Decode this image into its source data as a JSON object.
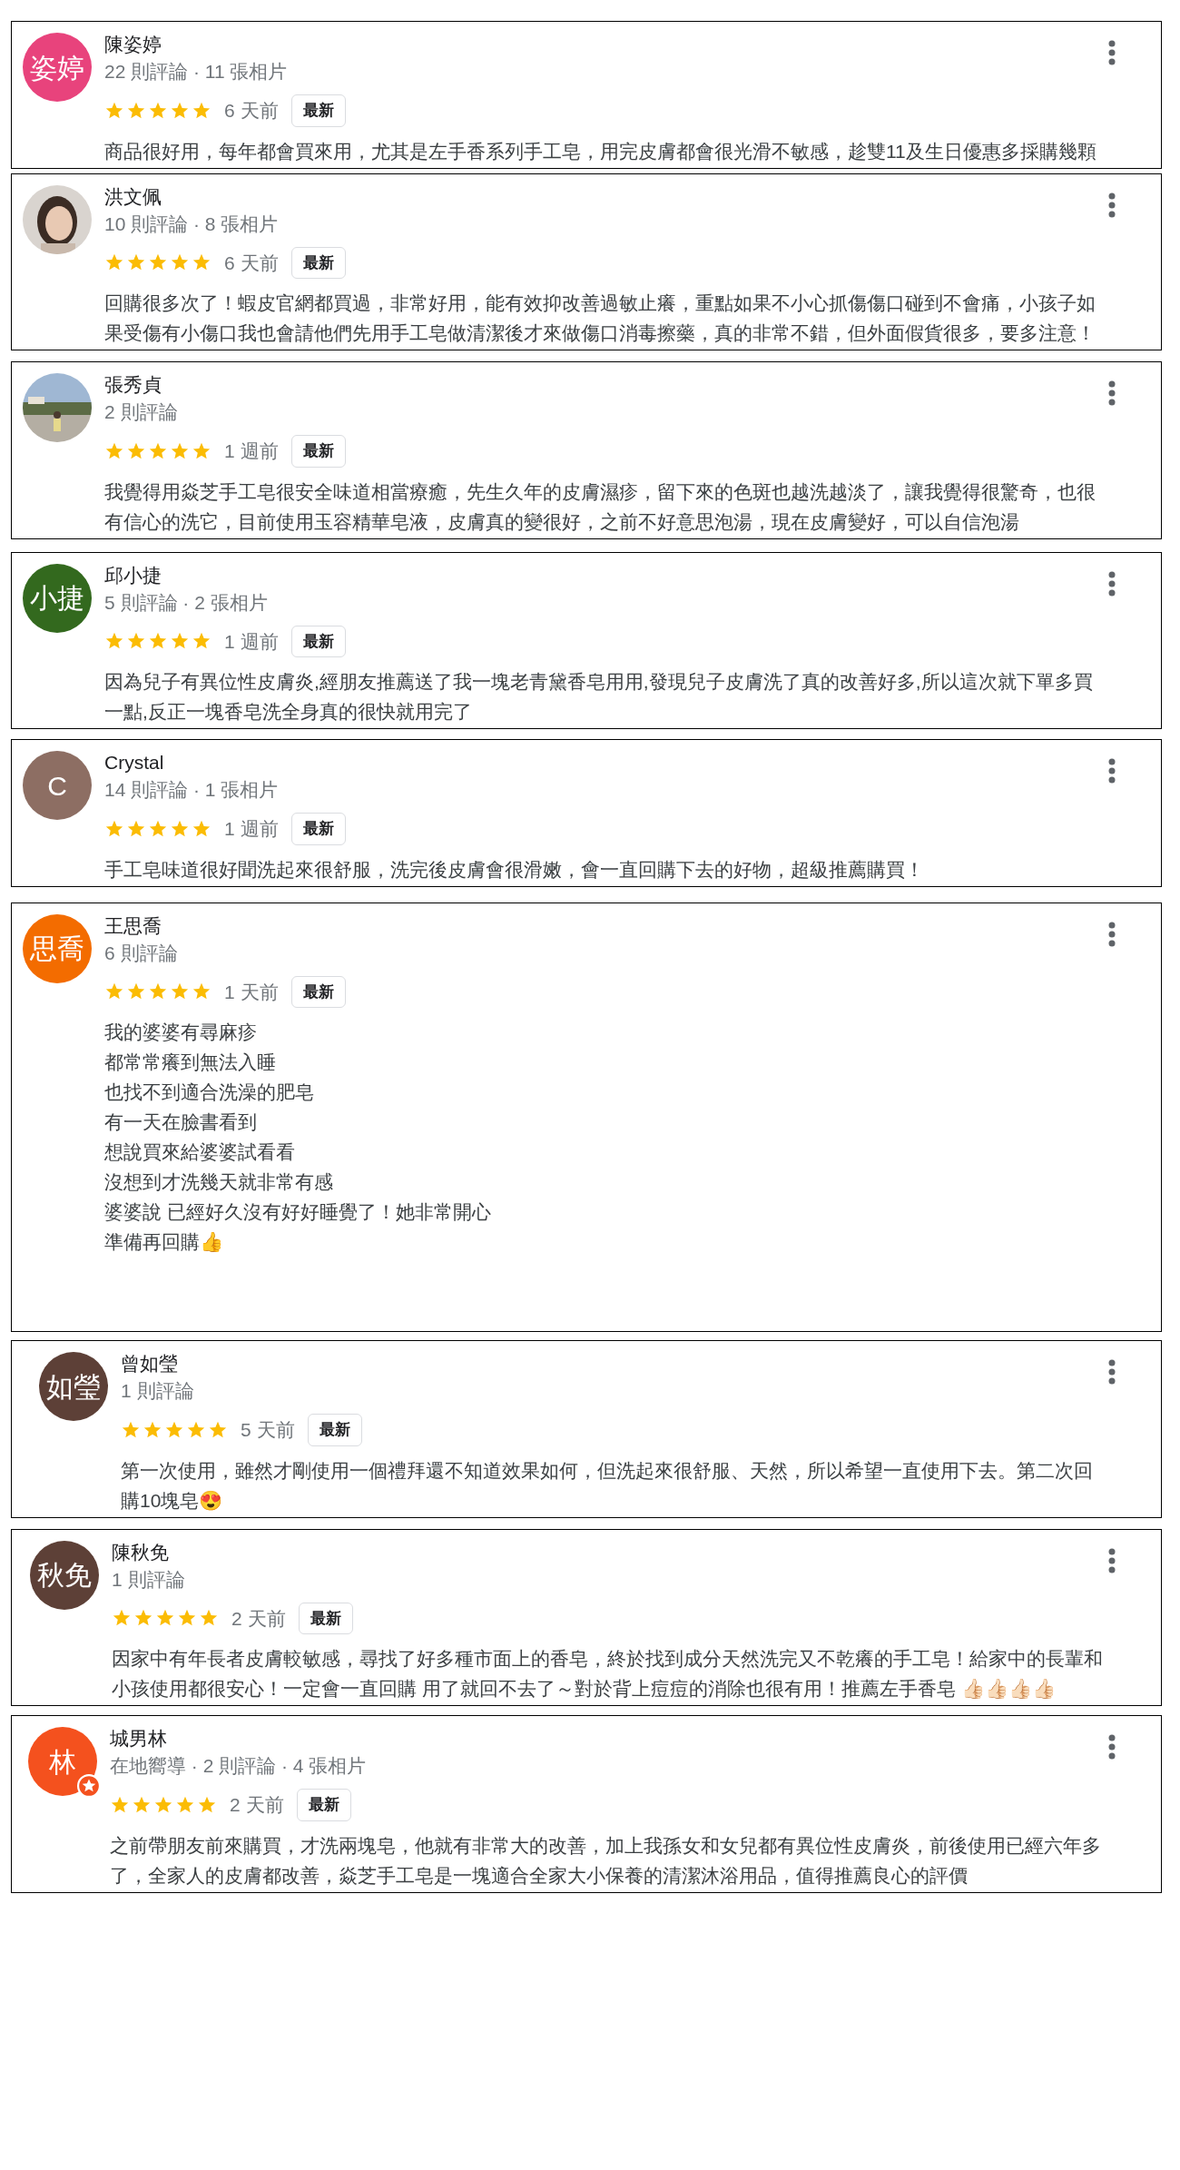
{
  "reviews": [
    {
      "name": "陳姿婷",
      "avatar": {
        "kind": "letters",
        "text": "姿婷",
        "color": "#e8437c"
      },
      "meta": "22 則評論 · 11 張相片",
      "stars": 5,
      "time": "6 天前",
      "badge": "最新",
      "body": [
        "商品很好用，每年都會買來用，尤其是左手香系列手工皂，用完皮膚都會很光滑不敏感，趁雙11及生日優惠多採購幾顆"
      ]
    },
    {
      "name": "洪文佩",
      "meta": "10 則評論 · 8 張相片",
      "stars": 5,
      "time": "6 天前",
      "badge": "最新",
      "body": [
        "回購很多次了！蝦皮官網都買過，非常好用，能有效抑改善過敏止癢，重點如果不小心抓傷傷口碰到不會痛，小孩子如果受傷有小傷口我也會請他們先用手工皂做清潔後才來做傷口消毒擦藥，真的非常不錯，但外面假貨很多，要多注意！"
      ]
    },
    {
      "name": "張秀貞",
      "meta": "2 則評論",
      "stars": 5,
      "time": "1 週前",
      "badge": "最新",
      "body": [
        "我覺得用焱芝手工皂很安全味道相當療癒，先生久年的皮膚濕疹，留下來的色斑也越洗越淡了，讓我覺得很驚奇，也很有信心的洗它，目前使用玉容精華皂液，皮膚真的變很好，之前不好意思泡湯，現在皮膚變好，可以自信泡湯"
      ]
    },
    {
      "name": "邱小捷",
      "avatar": {
        "kind": "letters",
        "text": "小捷",
        "color": "#33691e"
      },
      "meta": "5 則評論 · 2 張相片",
      "stars": 5,
      "time": "1 週前",
      "badge": "最新",
      "body": [
        "因為兒子有異位性皮膚炎,經朋友推薦送了我一塊老青黛香皂用用,發現兒子皮膚洗了真的改善好多,所以這次就下單多買一點,反正一塊香皂洗全身真的很快就用完了"
      ]
    },
    {
      "name": "Crystal",
      "avatar": {
        "kind": "letters",
        "text": "C",
        "color": "#8d6e63"
      },
      "meta": "14 則評論 · 1 張相片",
      "stars": 5,
      "time": "1 週前",
      "badge": "最新",
      "body": [
        "手工皂味道很好聞洗起來很舒服，洗完後皮膚會很滑嫩，會一直回購下去的好物，超級推薦購買！"
      ]
    },
    {
      "name": "王思喬",
      "avatar": {
        "kind": "letters",
        "text": "思喬",
        "color": "#f36c00"
      },
      "meta": "6 則評論",
      "stars": 5,
      "time": "1 天前",
      "badge": "最新",
      "body": [
        "我的婆婆有尋麻疹",
        "都常常癢到無法入睡",
        "也找不到適合洗澡的肥皂",
        "有一天在臉書看到",
        "想說買來給婆婆試看看",
        "沒想到才洗幾天就非常有感",
        "婆婆說 已經好久沒有好好睡覺了！她非常開心",
        "準備再回購👍"
      ]
    },
    {
      "name": "曾如瑩",
      "avatar": {
        "kind": "letters",
        "text": "如瑩",
        "color": "#5d4037"
      },
      "meta": "1 則評論",
      "stars": 5,
      "time": "5 天前",
      "badge": "最新",
      "body": [
        "第一次使用，雖然才剛使用一個禮拜還不知道效果如何，但洗起來很舒服、天然，所以希望一直使用下去。第二次回購10塊皂😍"
      ]
    },
    {
      "name": "陳秋免",
      "avatar": {
        "kind": "letters",
        "text": "秋免",
        "color": "#5d4037"
      },
      "meta": "1 則評論",
      "stars": 5,
      "time": "2 天前",
      "badge": "最新",
      "body": [
        "因家中有年長者皮膚較敏感，尋找了好多種市面上的香皂，終於找到成分天然洗完又不乾癢的手工皂！給家中的長輩和小孩使用都很安心！一定會一直回購 用了就回不去了～對於背上痘痘的消除也很有用！推薦左手香皂 👍🏻👍🏻👍🏻👍🏻"
      ]
    },
    {
      "name": "城男林",
      "avatar": {
        "kind": "letters",
        "text": "林",
        "color": "#f4511e",
        "guide": true
      },
      "meta": "在地嚮導 · 2 則評論 · 4 張相片",
      "stars": 5,
      "time": "2 天前",
      "badge": "最新",
      "body": [
        "之前帶朋友前來購買，才洗兩塊皂，他就有非常大的改善，加上我孫女和女兒都有異位性皮膚炎，前後使用已經六年多了，全家人的皮膚都改善，焱芝手工皂是一塊適合全家大小保養的清潔沐浴用品，值得推薦良心的評價"
      ]
    }
  ]
}
